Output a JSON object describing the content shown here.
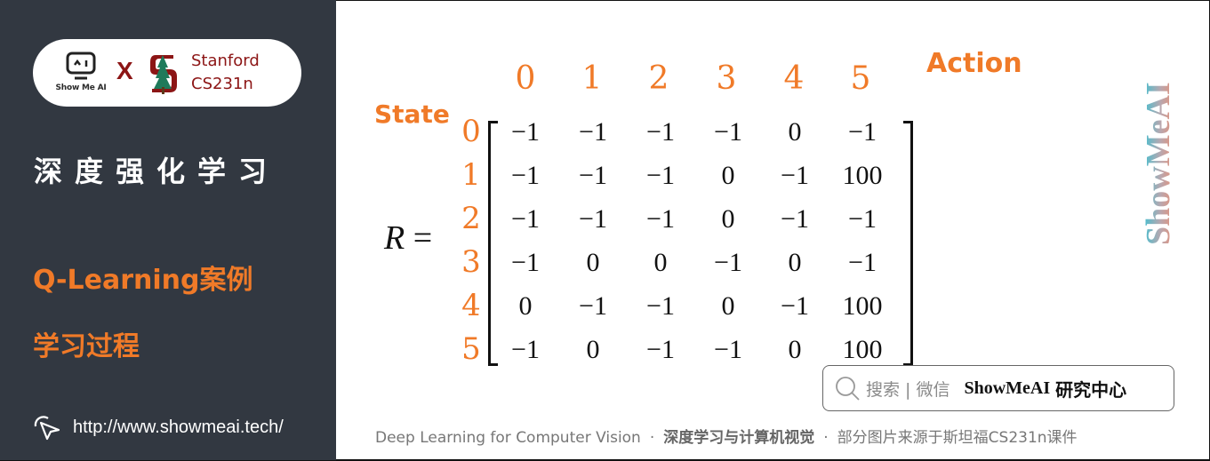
{
  "sidebar": {
    "logo": {
      "showmeai_text": "Show Me AI",
      "x_mark": "X",
      "stanford_line1": "Stanford",
      "stanford_line2": "CS231n"
    },
    "course_title": "深度强化学习",
    "topic_line1": "Q-Learning案例",
    "topic_line2": "学习过程",
    "url": "http://www.showmeai.tech/"
  },
  "matrix": {
    "lhs_symbol": "R",
    "equals": "=",
    "state_label": "State",
    "action_label": "Action",
    "column_headers": [
      "0",
      "1",
      "2",
      "3",
      "4",
      "5"
    ],
    "row_headers": [
      "0",
      "1",
      "2",
      "3",
      "4",
      "5"
    ],
    "rows": [
      [
        "−1",
        "−1",
        "−1",
        "−1",
        "0",
        "−1"
      ],
      [
        "−1",
        "−1",
        "−1",
        "0",
        "−1",
        "100"
      ],
      [
        "−1",
        "−1",
        "−1",
        "0",
        "−1",
        "−1"
      ],
      [
        "−1",
        "0",
        "0",
        "−1",
        "0",
        "−1"
      ],
      [
        "0",
        "−1",
        "−1",
        "0",
        "−1",
        "100"
      ],
      [
        "−1",
        "0",
        "−1",
        "−1",
        "0",
        "100"
      ]
    ]
  },
  "watermark": "ShowMeAI",
  "search_box": {
    "hint": "搜索 | 微信",
    "brand": "ShowMeAI",
    "brand_cn": "研究中心"
  },
  "footer": {
    "en": "Deep Learning for Computer Vision",
    "dot": "·",
    "cn_bold": "深度学习与计算机视觉",
    "source": "部分图片来源于斯坦福CS231n课件"
  },
  "colors": {
    "sidebar_bg": "#323841",
    "accent_orange": "#f07a28",
    "stanford_red": "#8c1515"
  }
}
